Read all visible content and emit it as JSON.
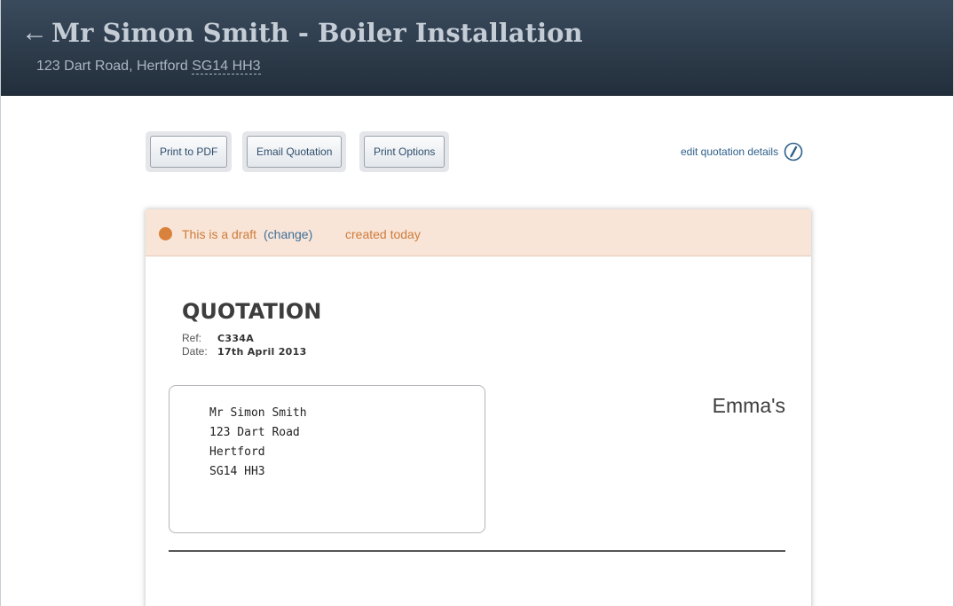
{
  "header": {
    "back_symbol": "←",
    "title": "Mr Simon Smith - Boiler Installation",
    "address_prefix": "123 Dart Road, Hertford",
    "postcode": "SG14 HH3"
  },
  "toolbar": {
    "print_pdf_label": "Print to PDF",
    "email_label": "Email Quotation",
    "print_options_label": "Print Options",
    "edit_details_label": "edit quotation details"
  },
  "draft": {
    "status_text": "This is a draft",
    "change_label": "(change)",
    "created_text": "created today",
    "accent_color": "#d9823d"
  },
  "document": {
    "heading": "QUOTATION",
    "ref_label": "Ref:",
    "ref_value": "C334A",
    "date_label": "Date:",
    "date_value": "17th April 2013",
    "recipient": [
      "Mr Simon Smith",
      "123 Dart Road",
      "Hertford",
      "SG14 HH3"
    ],
    "company_name": "Emma's"
  },
  "icons": {
    "back": "back-arrow-icon",
    "edit": "edit-pencil-icon"
  }
}
